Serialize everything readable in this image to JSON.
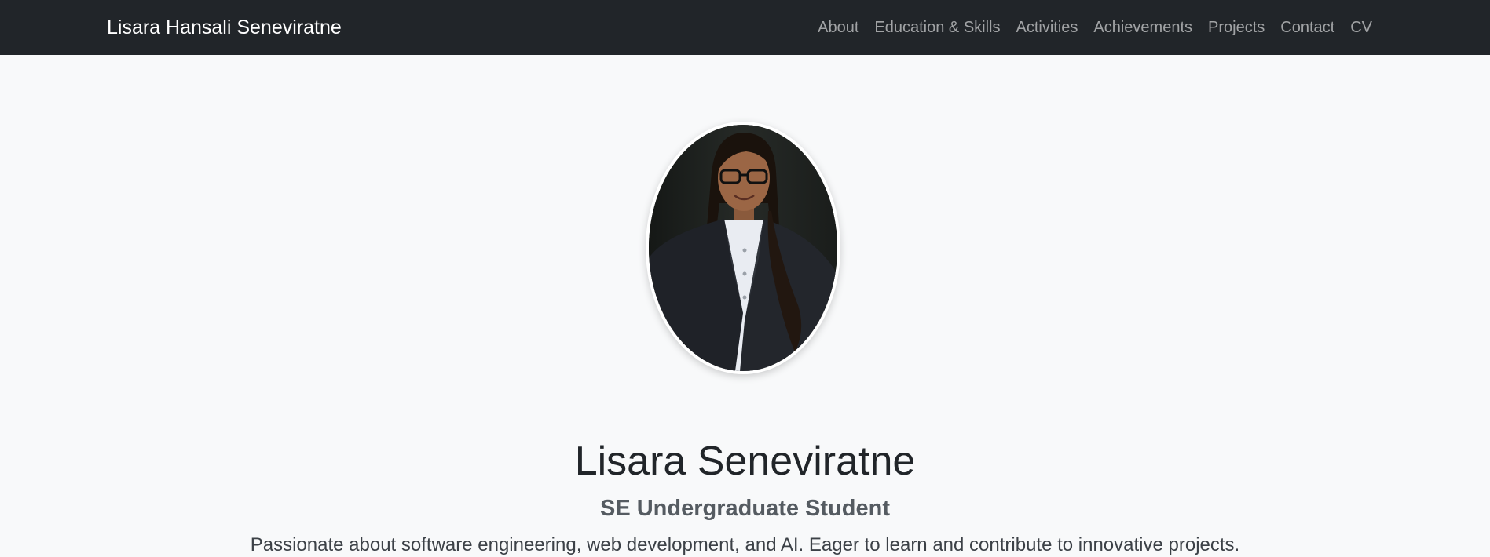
{
  "navbar": {
    "brand": "Lisara Hansali Seneviratne",
    "links": [
      {
        "label": "About"
      },
      {
        "label": "Education & Skills"
      },
      {
        "label": "Activities"
      },
      {
        "label": "Achievements"
      },
      {
        "label": "Projects"
      },
      {
        "label": "Contact"
      },
      {
        "label": "CV"
      }
    ]
  },
  "hero": {
    "name": "Lisara Seneviratne",
    "role": "SE Undergraduate Student",
    "description": "Passionate about software engineering, web development, and AI. Eager to learn and contribute to innovative projects."
  },
  "colors": {
    "navbar_bg": "#212529",
    "page_bg": "#f8f9fa",
    "nav_link": "rgba(255,255,255,0.58)",
    "name_text": "#212529",
    "role_text": "#555b61"
  }
}
